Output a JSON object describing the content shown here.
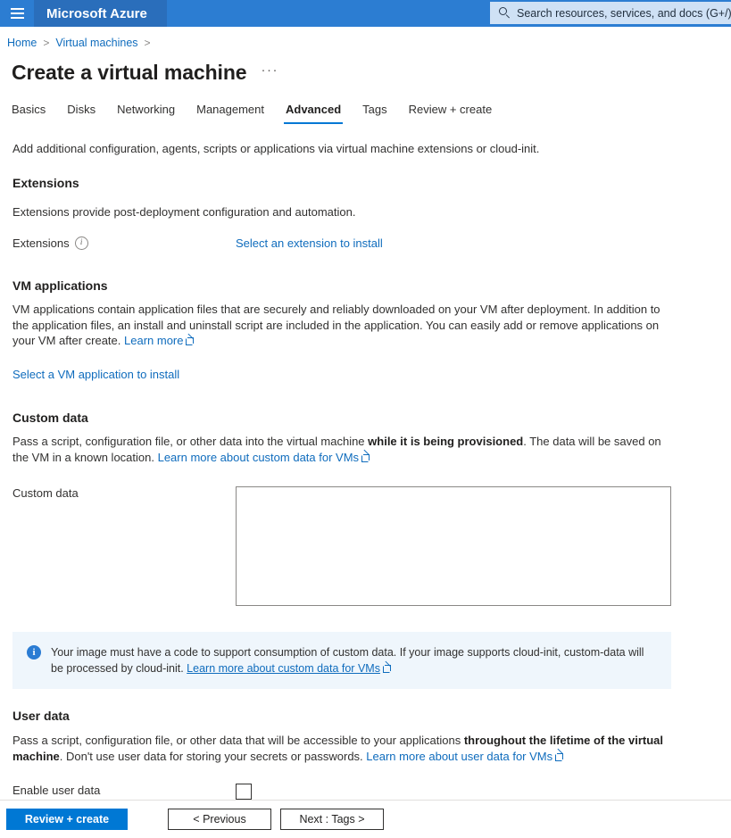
{
  "topbar": {
    "menu_icon": "hamburger-icon",
    "brand": "Microsoft Azure",
    "search": {
      "icon": "search-icon",
      "placeholder": "Search resources, services, and docs (G+/)"
    }
  },
  "breadcrumb": {
    "items": [
      "Home",
      "Virtual machines"
    ],
    "separator": ">"
  },
  "page": {
    "title": "Create a virtual machine",
    "more_actions": "···"
  },
  "tabs": [
    {
      "label": "Basics",
      "active": false
    },
    {
      "label": "Disks",
      "active": false
    },
    {
      "label": "Networking",
      "active": false
    },
    {
      "label": "Management",
      "active": false
    },
    {
      "label": "Advanced",
      "active": true
    },
    {
      "label": "Tags",
      "active": false
    },
    {
      "label": "Review + create",
      "active": false
    }
  ],
  "advanced": {
    "intro": "Add additional configuration, agents, scripts or applications via virtual machine extensions or cloud-init.",
    "extensions": {
      "heading": "Extensions",
      "description": "Extensions provide post-deployment configuration and automation.",
      "field_label": "Extensions",
      "info_icon": "info-circle-icon",
      "select_link": "Select an extension to install"
    },
    "vm_applications": {
      "heading": "VM applications",
      "description_1": "VM applications contain application files that are securely and reliably downloaded on your VM after deployment. In addition to the application files, an install and uninstall script are included in the application. You can easily add or remove applications on your VM after create. ",
      "learn_more": "Learn more",
      "select_link": "Select a VM application to install"
    },
    "custom_data": {
      "heading": "Custom data",
      "description_before_bold": "Pass a script, configuration file, or other data into the virtual machine ",
      "description_bold": "while it is being provisioned",
      "description_after_bold": ". The data will be saved on the VM in a known location. ",
      "learn_more": "Learn more about custom data for VMs",
      "field_label": "Custom data",
      "textarea_value": "",
      "textarea_placeholder": "",
      "banner": {
        "icon": "info-circle-filled-icon",
        "text_before_link": "Your image must have a code to support consumption of custom data. If your image supports cloud-init, custom-data will be processed by cloud-init. ",
        "link": "Learn more about custom data for VMs"
      }
    },
    "user_data": {
      "heading": "User data",
      "description_before_bold": "Pass a script, configuration file, or other data that will be accessible to your applications ",
      "description_bold": "throughout the lifetime of the virtual machine",
      "description_after_bold": ". Don't use user data for storing your secrets or passwords. ",
      "learn_more": "Learn more about user data for VMs",
      "enable_label": "Enable user data",
      "enable_checked": false
    }
  },
  "footer": {
    "review_create": "Review + create",
    "previous": "< Previous",
    "next": "Next : Tags >"
  },
  "colors": {
    "azure_blue": "#2c7dd2",
    "brand_blue": "#2a6ebb",
    "accent": "#0078d4",
    "link": "#0f6cbd",
    "banner_bg": "#eff6fc"
  }
}
